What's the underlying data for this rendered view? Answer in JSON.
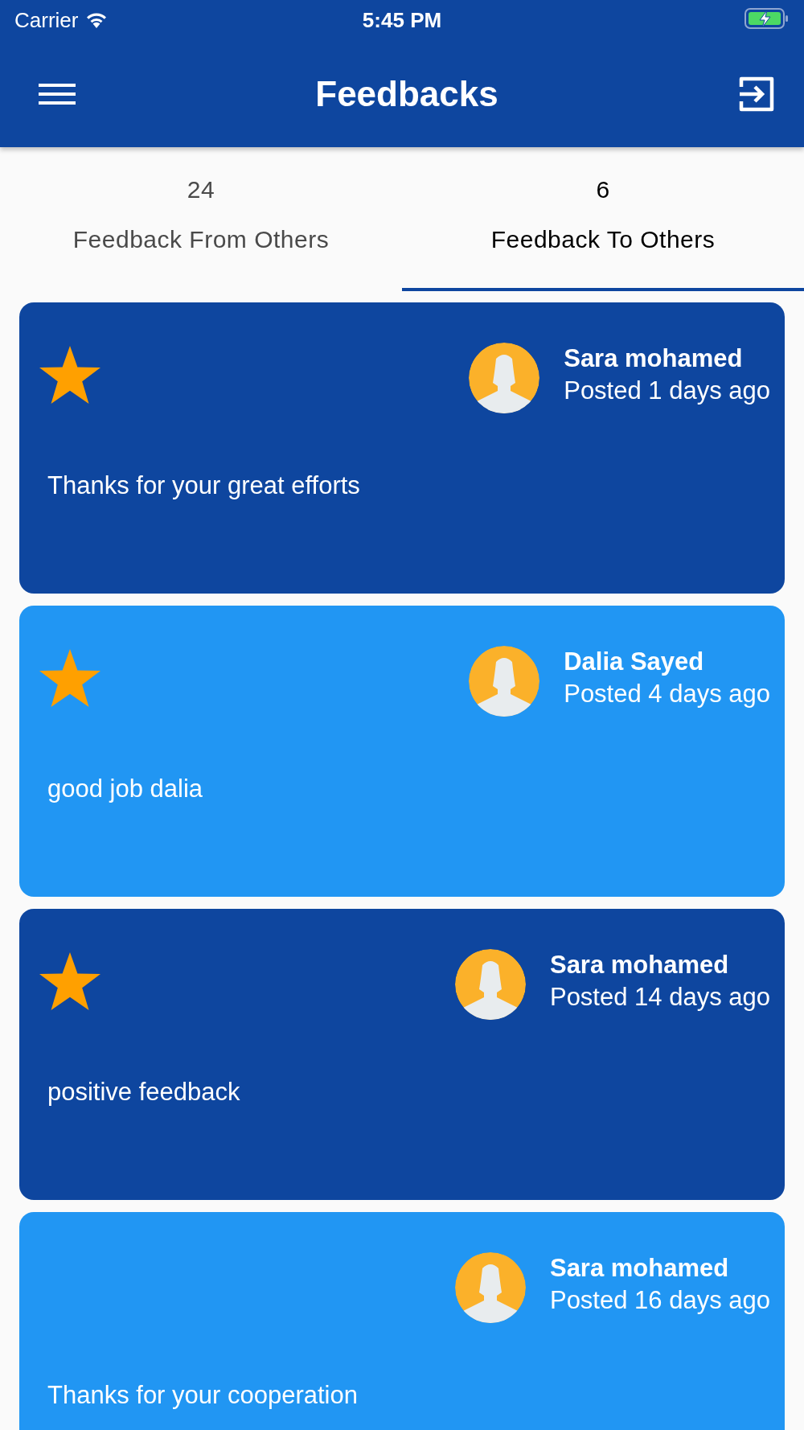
{
  "status_bar": {
    "carrier": "Carrier",
    "time": "5:45 PM"
  },
  "app_bar": {
    "title": "Feedbacks"
  },
  "tabs": [
    {
      "count": "24",
      "label": "Feedback From Others",
      "selected": false
    },
    {
      "count": "6",
      "label": "Feedback To Others",
      "selected": true
    }
  ],
  "feedbacks": [
    {
      "starred": true,
      "color": "#0e469f",
      "name": "Sara mohamed",
      "posted": "Posted 1 days ago",
      "message": "Thanks for your great efforts"
    },
    {
      "starred": true,
      "color": "#2196f3",
      "name": "Dalia Sayed",
      "posted": "Posted 4 days ago",
      "message": "good job dalia"
    },
    {
      "starred": true,
      "color": "#0e469f",
      "name": "Sara mohamed",
      "posted": "Posted 14 days ago",
      "message": "positive feedback"
    },
    {
      "starred": false,
      "color": "#2196f3",
      "name": "Sara mohamed",
      "posted": "Posted 16 days ago",
      "message": "Thanks for your cooperation"
    }
  ]
}
